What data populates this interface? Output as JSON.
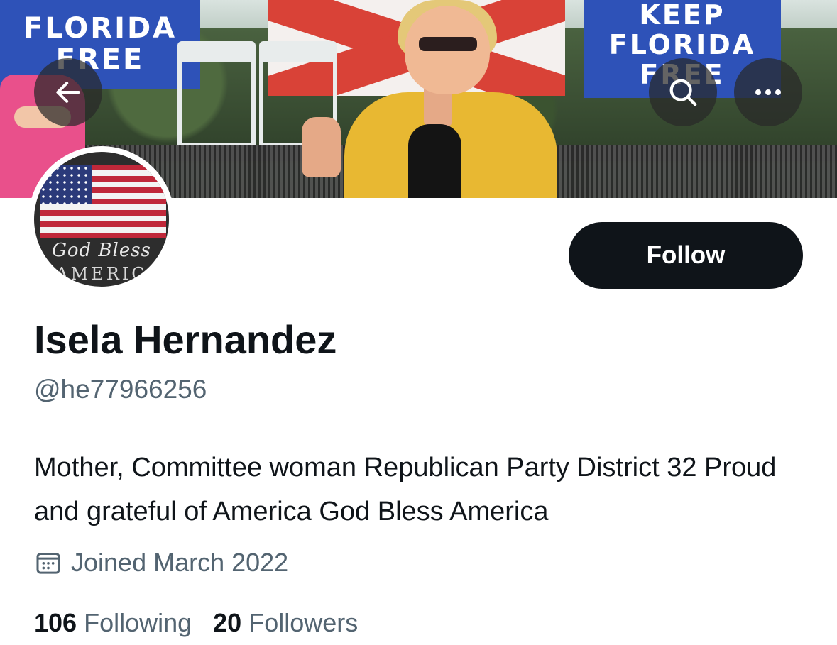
{
  "banner": {
    "sign_left_lines": [
      "FLORIDA",
      "FREE"
    ],
    "sign_right_lines": [
      "KEEP",
      "FLORIDA",
      "FREE"
    ],
    "photo_description_icon": "banner-photo"
  },
  "header_buttons": {
    "back_icon": "arrow-left-icon",
    "search_icon": "search-icon",
    "more_icon": "ellipsis-icon"
  },
  "avatar": {
    "text_line1": "God Bless",
    "text_line2": "AMERIC"
  },
  "follow": {
    "label": "Follow"
  },
  "profile": {
    "name": "Isela Hernandez",
    "handle": "@he77966256",
    "bio": "Mother, Committee woman Republican Party District 32 Proud and grateful of America God Bless America",
    "joined": "Joined March 2022",
    "joined_icon": "calendar-icon"
  },
  "stats": {
    "following_count": "106",
    "following_label": "Following",
    "followers_count": "20",
    "followers_label": "Followers"
  },
  "colors": {
    "text_primary": "#0f1419",
    "text_secondary": "#536471",
    "follow_bg": "#0f1419",
    "sign_blue": "#2e52b8"
  }
}
